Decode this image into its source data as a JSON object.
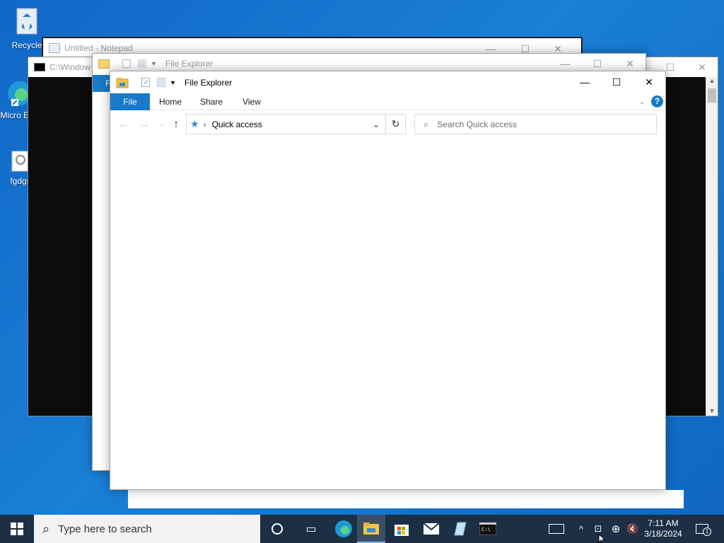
{
  "desktop": {
    "icons": [
      {
        "label": "Recycle",
        "icon": "recycle-bin-icon"
      },
      {
        "label": "Micro Ed",
        "icon": "edge-icon"
      },
      {
        "label": "fgdgs",
        "icon": "settings-file-icon"
      }
    ]
  },
  "notepad": {
    "title": "Untitled - Notepad"
  },
  "cmd": {
    "title": "C:\\Window"
  },
  "explorer_back": {
    "title": "File Explorer",
    "tab_file": "F"
  },
  "explorer": {
    "title": "File Explorer",
    "tabs": [
      "File",
      "Home",
      "Share",
      "View"
    ],
    "address": {
      "location": "Quick access"
    },
    "search": {
      "placeholder": "Search Quick access"
    },
    "help": "?"
  },
  "taskbar": {
    "start_icon": "windows-logo-icon",
    "search_placeholder": "Type here to search",
    "apps": [
      "cortana-icon",
      "task-view-icon",
      "edge-icon",
      "file-explorer-icon",
      "store-icon",
      "mail-icon",
      "notepad-icon",
      "cmd-icon"
    ],
    "tray": {
      "time": "7:11 AM",
      "date": "3/18/2024",
      "notification_count": "1"
    }
  },
  "colors": {
    "desktop": "#1a7fd6",
    "taskbar": "#1c2f45",
    "ribbon_file": "#1979ca",
    "help": "#1979ca"
  }
}
